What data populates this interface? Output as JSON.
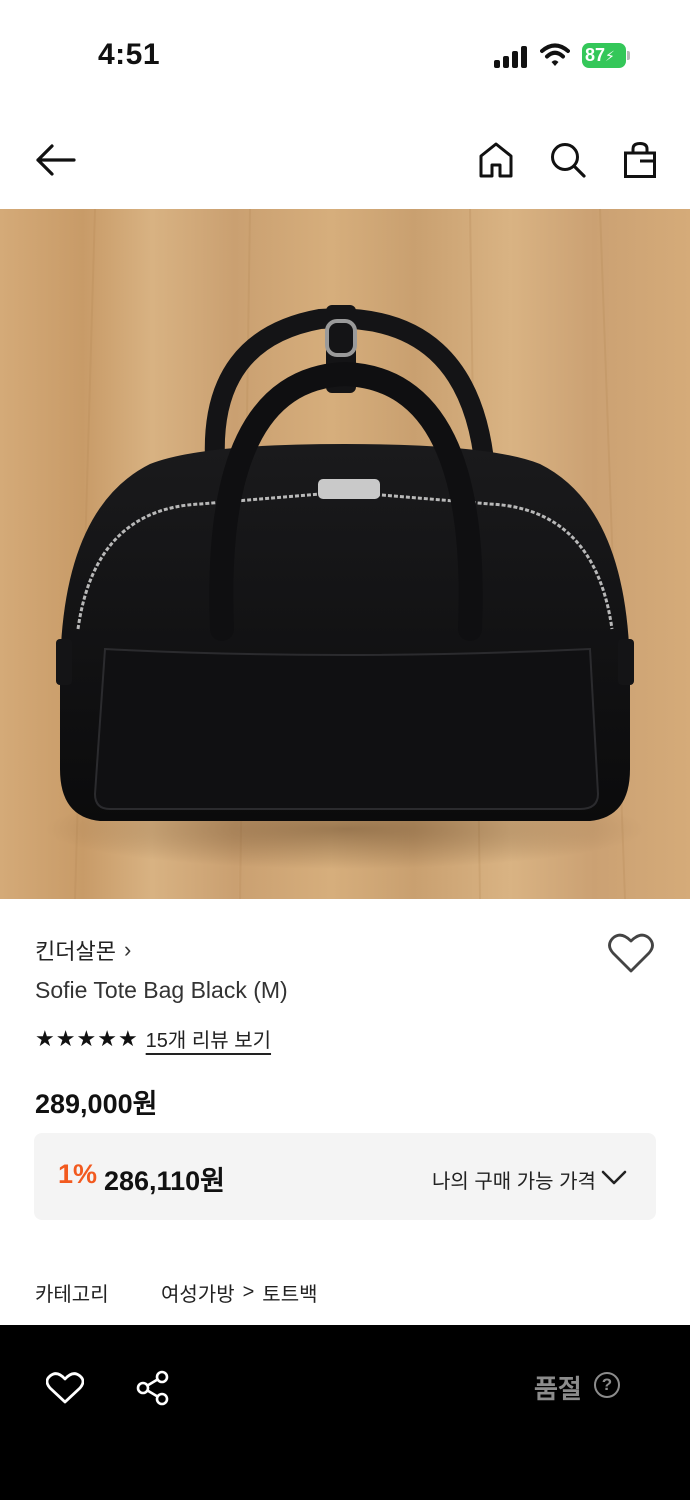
{
  "status_bar": {
    "time": "4:51",
    "battery": "87"
  },
  "nav": {
    "back_icon": "arrow-left-icon",
    "home_icon": "home-icon",
    "search_icon": "search-icon",
    "cart_icon": "shopping-bag-icon"
  },
  "product": {
    "brand": "킨더살몬",
    "brand_chevron": "›",
    "name": "Sofie Tote Bag Black (M)",
    "rating_stars": 5,
    "review_link": "15개 리뷰 보기",
    "price": "289,000원",
    "discount": {
      "rate": "1%",
      "price": "286,110원",
      "my_price_label": "나의 구매 가능 가격"
    },
    "category": {
      "label": "카테고리",
      "path": [
        "여성가방",
        "토트백"
      ],
      "separator": ">"
    }
  },
  "bottom_bar": {
    "soldout_label": "품절",
    "help_symbol": "?"
  },
  "colors": {
    "accent": "#f25a1f",
    "battery": "#34c759",
    "bottom_bar_bg": "#000000",
    "soldout_text": "#8c8c8c"
  }
}
